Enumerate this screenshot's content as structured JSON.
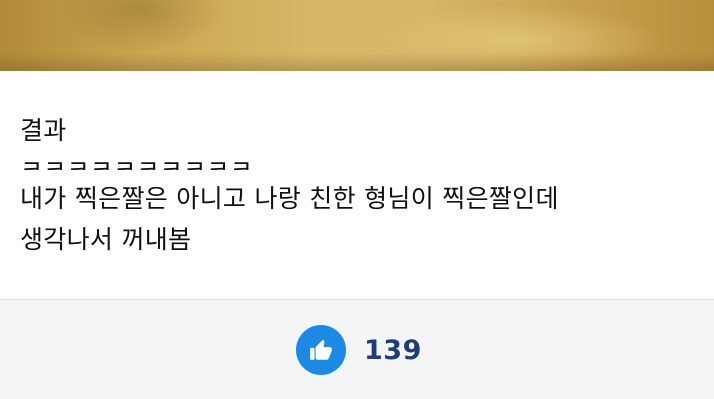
{
  "post": {
    "lines": [
      "결과",
      "ㅋㅋㅋㅋㅋㅋㅋㅋㅋㅋ",
      "내가 찍은짤은 아니고 나랑 친한 형님이 찍은짤인데",
      "생각나서 꺼내봄"
    ]
  },
  "footer": {
    "like_icon": "thumbs-up-icon",
    "like_count": "139",
    "like_button_color": "#1e88e5",
    "like_count_color": "#1f3d7a"
  }
}
